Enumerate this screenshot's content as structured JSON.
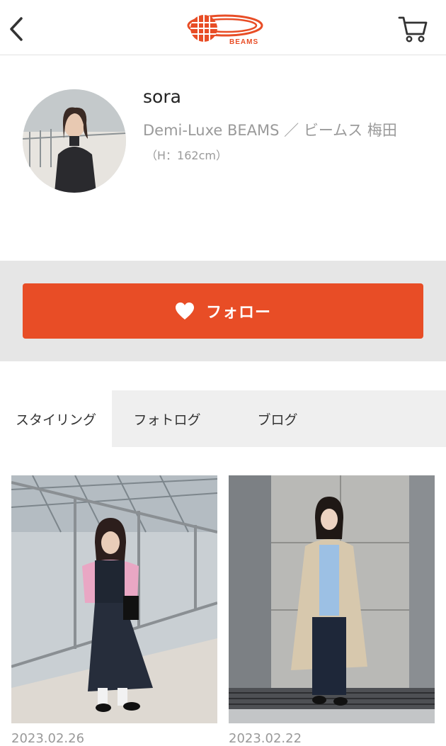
{
  "header": {
    "back_icon": "chevron-left-icon",
    "logo_text": "BEAMS",
    "cart_icon": "cart-icon"
  },
  "profile": {
    "name": "sora",
    "shop": "Demi-Luxe BEAMS ／ ビームス 梅田",
    "height": "（H：162cm）"
  },
  "follow": {
    "label": "フォロー",
    "icon": "heart-icon",
    "color": "#e84d26"
  },
  "tabs": [
    {
      "label": "スタイリング",
      "active": true
    },
    {
      "label": "フォトログ",
      "active": false
    },
    {
      "label": "ブログ",
      "active": false
    }
  ],
  "posts": [
    {
      "date": "2023.02.26"
    },
    {
      "date": "2023.02.22"
    }
  ],
  "colors": {
    "accent": "#e84d26",
    "band": "#e6e6e6",
    "tab_bg": "#efefef"
  }
}
